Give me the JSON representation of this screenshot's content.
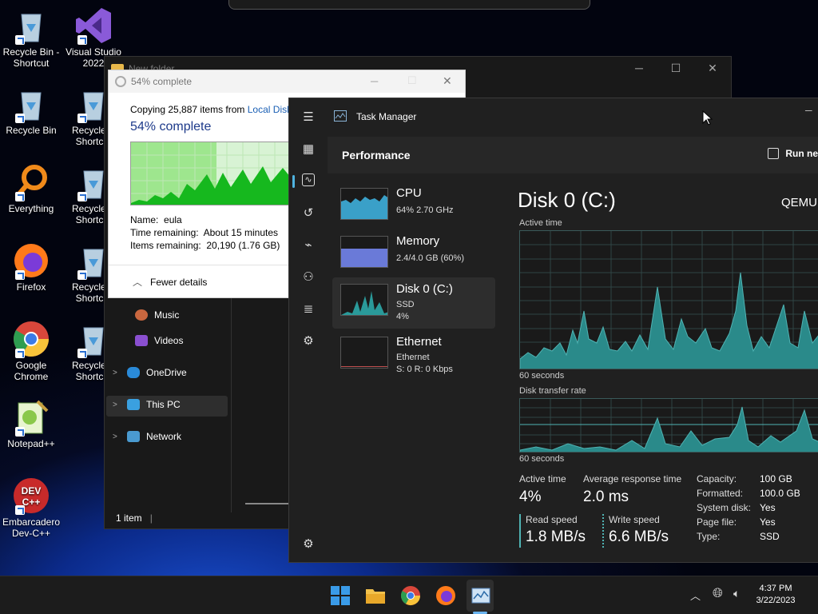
{
  "desktop": {
    "icons": [
      {
        "label": "Recycle Bin -\nShortcut",
        "icon": "recycle-bin-icon"
      },
      {
        "label": "Visual Studio\n2022",
        "icon": "visual-studio-icon"
      },
      {
        "label": "Recycle Bin",
        "icon": "recycle-bin-icon"
      },
      {
        "label": "Recycle B\nShortcut",
        "icon": "recycle-bin-icon"
      },
      {
        "label": "Everything",
        "icon": "everything-search-icon"
      },
      {
        "label": "Recycle B\nShortcut",
        "icon": "recycle-bin-icon"
      },
      {
        "label": "Firefox",
        "icon": "firefox-icon"
      },
      {
        "label": "Recycle B\nShortcut",
        "icon": "recycle-bin-icon"
      },
      {
        "label": "Google\nChrome",
        "icon": "chrome-icon"
      },
      {
        "label": "Recycle B\nShortcut",
        "icon": "recycle-bin-icon"
      },
      {
        "label": "Notepad++",
        "icon": "notepadpp-icon"
      },
      {
        "label": "Embarcadero\nDev-C++",
        "icon": "devcpp-icon"
      }
    ]
  },
  "explorer": {
    "title": "New folder",
    "nav": {
      "music": "Music",
      "videos": "Videos",
      "onedrive": "OneDrive",
      "thispc": "This PC",
      "network": "Network"
    },
    "status": "1 item"
  },
  "copy_dialog": {
    "title": "54% complete",
    "copying_prefix": "Copying 25,887 items from ",
    "copying_link": "Local Disk",
    "heading": "54% complete",
    "progress": 0.54,
    "name_label": "Name:",
    "name_value": "eula",
    "time_label": "Time remaining:",
    "time_value": "About 15 minutes",
    "items_label": "Items remaining:",
    "items_value": "20,190 (1.76 GB)",
    "fewer_details": "Fewer details"
  },
  "task_manager": {
    "title": "Task Manager",
    "section": "Performance",
    "run_new": "Run ne",
    "items": [
      {
        "title": "CPU",
        "line1": "64%  2.70 GHz",
        "line2": ""
      },
      {
        "title": "Memory",
        "line1": "2.4/4.0 GB (60%)",
        "line2": ""
      },
      {
        "title": "Disk 0 (C:)",
        "line1": "SSD",
        "line2": "4%"
      },
      {
        "title": "Ethernet",
        "line1": "Ethernet",
        "line2": "S: 0 R: 0 Kbps"
      }
    ],
    "detail": {
      "title": "Disk 0 (C:)",
      "model": "QEMU",
      "active_time_label": "Active time",
      "seconds1": "60 seconds",
      "transfer_label": "Disk transfer rate",
      "seconds2": "60 seconds",
      "active_time": {
        "label": "Active time",
        "value": "4%"
      },
      "avg_response": {
        "label": "Average response time",
        "value": "2.0 ms"
      },
      "read_speed": {
        "label": "Read speed",
        "value": "1.8 MB/s"
      },
      "write_speed": {
        "label": "Write speed",
        "value": "6.6 MB/s"
      },
      "props": [
        {
          "k": "Capacity:",
          "v": "100 GB"
        },
        {
          "k": "Formatted:",
          "v": "100.0 GB"
        },
        {
          "k": "System disk:",
          "v": "Yes"
        },
        {
          "k": "Page file:",
          "v": "Yes"
        },
        {
          "k": "Type:",
          "v": "SSD"
        }
      ]
    }
  },
  "taskbar": {
    "time": "4:37 PM",
    "date": "3/22/2023"
  },
  "colors": {
    "accent": "#4fb3b3",
    "graph_fill": "#2a8a8a",
    "progress_green": "#16b81e"
  }
}
